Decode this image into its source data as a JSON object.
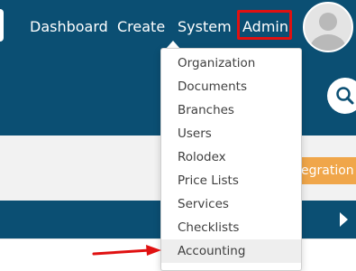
{
  "colors": {
    "nav_bg": "#0b4f73",
    "admin_highlight": "#e01111",
    "integration_button": "#f0a64a",
    "annotation_arrow": "#e01111"
  },
  "nav": {
    "items": [
      {
        "label": "Dashboard"
      },
      {
        "label": "Create"
      },
      {
        "label": "System"
      },
      {
        "label": "Admin"
      }
    ]
  },
  "avatar": {
    "icon": "user-avatar-icon"
  },
  "search": {
    "icon": "search-icon"
  },
  "toolbar": {
    "integration_label": "egration",
    "integration_icon": "chevron-down-icon"
  },
  "section_bar": {
    "toggle_icon": "triangle-right-icon"
  },
  "admin_menu": {
    "items": [
      {
        "label": "Organization"
      },
      {
        "label": "Documents"
      },
      {
        "label": "Branches"
      },
      {
        "label": "Users"
      },
      {
        "label": "Rolodex"
      },
      {
        "label": "Price Lists"
      },
      {
        "label": "Services"
      },
      {
        "label": "Checklists"
      },
      {
        "label": "Accounting"
      }
    ],
    "highlighted_item": "Accounting"
  },
  "annotation": {
    "icon": "arrow-right-icon"
  }
}
